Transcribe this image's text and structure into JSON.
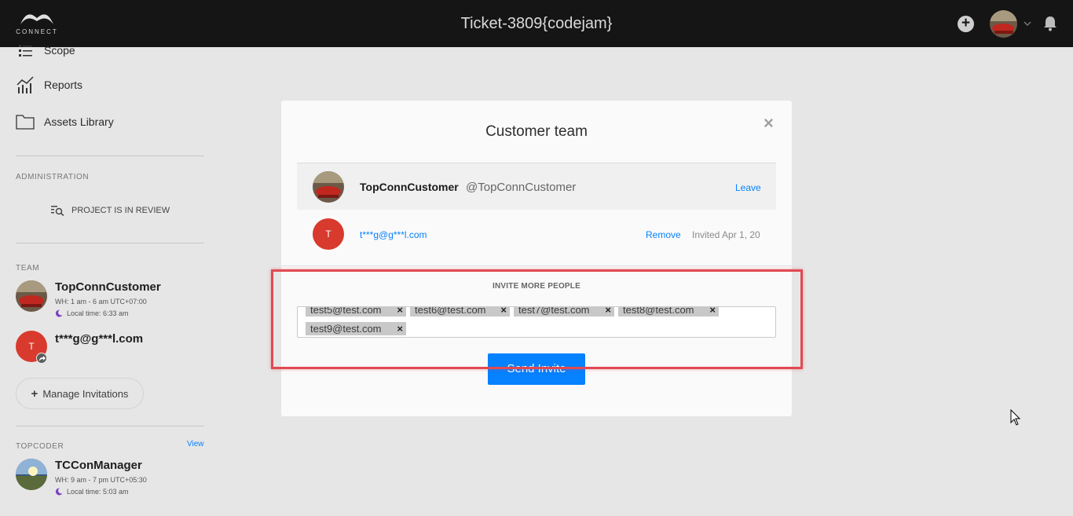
{
  "header": {
    "brand": "CONNECT",
    "title": "Ticket-3809{codejam}"
  },
  "sidebar": {
    "nav": [
      {
        "label": "Scope",
        "icon": "list-icon"
      },
      {
        "label": "Reports",
        "icon": "chart-icon"
      },
      {
        "label": "Assets Library",
        "icon": "folder-icon"
      }
    ],
    "admin_label": "ADMINISTRATION",
    "review_status": "PROJECT IS IN REVIEW",
    "team_label": "TEAM",
    "team": [
      {
        "name": "TopConnCustomer",
        "working_hours": "WH: 1 am - 6 am UTC+07:00",
        "local_time": "Local time: 6:33 am"
      },
      {
        "name": "t***g@g***l.com",
        "initial": "T"
      }
    ],
    "manage_label": "Manage Invitations",
    "topcoder_label": "TOPCODER",
    "view_label": "View",
    "manager": {
      "name": "TCConManager",
      "working_hours": "WH: 9 am - 7 pm UTC+05:30",
      "local_time": "Local time: 5:03 am"
    }
  },
  "modal": {
    "title": "Customer team",
    "close": "×",
    "members": [
      {
        "name": "TopConnCustomer",
        "handle": "@TopConnCustomer",
        "action": "Leave"
      },
      {
        "initial": "T",
        "email": "t***g@g***l.com",
        "action": "Remove",
        "status": "Invited Apr 1, 20"
      }
    ],
    "invite_label": "INVITE MORE PEOPLE",
    "tags": [
      "test5@test.com",
      "test6@test.com",
      "test7@test.com",
      "test8@test.com",
      "test9@test.com"
    ],
    "tag_remove": "×",
    "send_label": "Send Invite"
  },
  "colors": {
    "accent": "#0681ff",
    "highlight": "#e14a52",
    "topbar": "#151515",
    "avatar_red": "#d83a2d"
  }
}
